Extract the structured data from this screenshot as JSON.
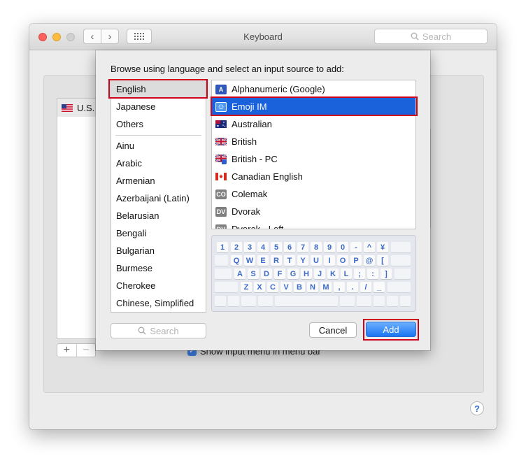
{
  "window": {
    "title": "Keyboard",
    "search_placeholder": "Search",
    "nav_back": "‹",
    "nav_forward": "›",
    "traffic_lights": {
      "close": "#fc605c",
      "minimize": "#fdbc40",
      "zoom": "#d0d0d0"
    }
  },
  "background": {
    "list_item": "U.S.",
    "checkbox_label": "Show input menu in menu bar",
    "plus_label": "+",
    "minus_label": "−",
    "help_label": "?"
  },
  "sheet": {
    "prompt": "Browse using language and select an input source to add:",
    "languages_top": [
      "English",
      "Japanese",
      "Others"
    ],
    "languages": [
      "Ainu",
      "Arabic",
      "Armenian",
      "Azerbaijani (Latin)",
      "Belarusian",
      "Bengali",
      "Bulgarian",
      "Burmese",
      "Cherokee",
      "Chinese, Simplified"
    ],
    "selected_language": "English",
    "sources": [
      {
        "label": "Alphanumeric (Google)",
        "icon": "google-ime-icon",
        "badge": "A"
      },
      {
        "label": "Emoji IM",
        "icon": "emoji-icon",
        "badge": "☺"
      },
      {
        "label": "Australian",
        "icon": "australia-flag-icon",
        "badge": ""
      },
      {
        "label": "British",
        "icon": "uk-flag-icon",
        "badge": ""
      },
      {
        "label": "British - PC",
        "icon": "uk-flag-pc-icon",
        "badge": ""
      },
      {
        "label": "Canadian English",
        "icon": "canada-flag-icon",
        "badge": ""
      },
      {
        "label": "Colemak",
        "icon": "colemak-icon",
        "badge": "CO"
      },
      {
        "label": "Dvorak",
        "icon": "dvorak-icon",
        "badge": "DV"
      },
      {
        "label": "Dvorak - Left",
        "icon": "dvorak-left-icon",
        "badge": "DV"
      }
    ],
    "selected_source": "Emoji IM",
    "keyboard": {
      "row1": [
        "1",
        "2",
        "3",
        "4",
        "5",
        "6",
        "7",
        "8",
        "9",
        "0",
        "-",
        "^",
        "¥"
      ],
      "row2": [
        "Q",
        "W",
        "E",
        "R",
        "T",
        "Y",
        "U",
        "I",
        "O",
        "P",
        "@",
        "["
      ],
      "row3": [
        "A",
        "S",
        "D",
        "F",
        "G",
        "H",
        "J",
        "K",
        "L",
        ";",
        ":",
        "]"
      ],
      "row4": [
        "Z",
        "X",
        "C",
        "V",
        "B",
        "N",
        "M",
        ",",
        ".",
        "/",
        "_"
      ]
    },
    "search_placeholder": "Search",
    "cancel_label": "Cancel",
    "add_label": "Add",
    "accent_color": "#1a62dc",
    "highlight_color": "#d0021b"
  }
}
